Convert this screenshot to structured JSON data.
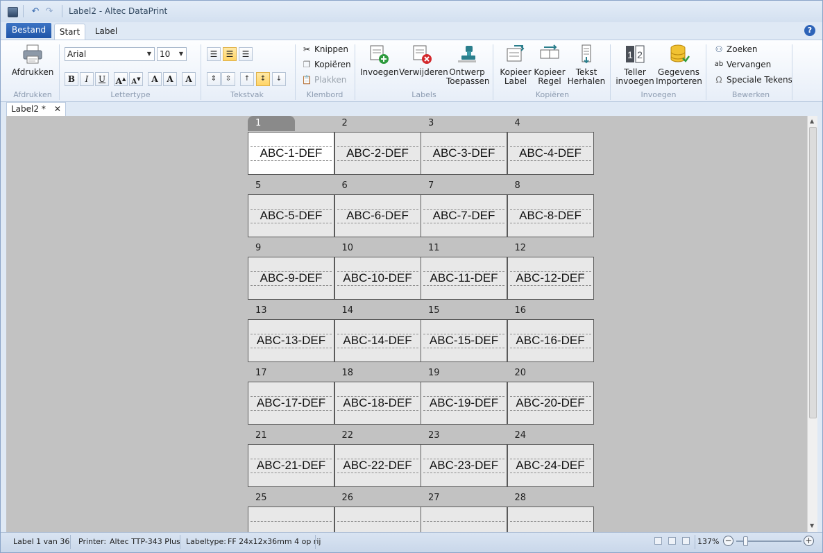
{
  "window": {
    "title": "Label2 - Altec DataPrint"
  },
  "ribbon_tabs": {
    "file": "Bestand",
    "start": "Start",
    "label": "Label"
  },
  "groups": {
    "afdrukken": "Afdrukken",
    "lettertype": "Lettertype",
    "tekstvak": "Tekstvak",
    "klembord": "Klembord",
    "labels": "Labels",
    "kopieren": "Kopiëren",
    "invoegen": "Invoegen",
    "bewerken": "Bewerken"
  },
  "buttons": {
    "print": "Afdrukken",
    "cut": "Knippen",
    "copy": "Kopiëren",
    "paste": "Plakken",
    "insert_l1": "Invoegen",
    "delete_l1": "Verwijderen",
    "design_l1": "Ontwerp",
    "design_l2": "Toepassen",
    "copylabel_l1": "Kopieer",
    "copylabel_l2": "Label",
    "copyrow_l1": "Kopieer",
    "copyrow_l2": "Regel",
    "repeat_l1": "Tekst",
    "repeat_l2": "Herhalen",
    "counter_l1": "Teller",
    "counter_l2": "invoegen",
    "import_l1": "Gegevens",
    "import_l2": "Importeren",
    "find": "Zoeken",
    "replace": "Vervangen",
    "special": "Speciale Tekens"
  },
  "font": {
    "name": "Arial",
    "size": "10"
  },
  "doc_tab": {
    "name": "Label2 *"
  },
  "labels": {
    "rows": [
      {
        "nums": [
          "1",
          "2",
          "3",
          "4"
        ],
        "texts": [
          "ABC-1-DEF",
          "ABC-2-DEF",
          "ABC-3-DEF",
          "ABC-4-DEF"
        ]
      },
      {
        "nums": [
          "5",
          "6",
          "7",
          "8"
        ],
        "texts": [
          "ABC-5-DEF",
          "ABC-6-DEF",
          "ABC-7-DEF",
          "ABC-8-DEF"
        ]
      },
      {
        "nums": [
          "9",
          "10",
          "11",
          "12"
        ],
        "texts": [
          "ABC-9-DEF",
          "ABC-10-DEF",
          "ABC-11-DEF",
          "ABC-12-DEF"
        ]
      },
      {
        "nums": [
          "13",
          "14",
          "15",
          "16"
        ],
        "texts": [
          "ABC-13-DEF",
          "ABC-14-DEF",
          "ABC-15-DEF",
          "ABC-16-DEF"
        ]
      },
      {
        "nums": [
          "17",
          "18",
          "19",
          "20"
        ],
        "texts": [
          "ABC-17-DEF",
          "ABC-18-DEF",
          "ABC-19-DEF",
          "ABC-20-DEF"
        ]
      },
      {
        "nums": [
          "21",
          "22",
          "23",
          "24"
        ],
        "texts": [
          "ABC-21-DEF",
          "ABC-22-DEF",
          "ABC-23-DEF",
          "ABC-24-DEF"
        ]
      },
      {
        "nums": [
          "25",
          "26",
          "27",
          "28"
        ],
        "texts": [
          "",
          "",
          "",
          ""
        ]
      }
    ]
  },
  "status": {
    "label": "Label 1 van 36",
    "printer_label": "Printer:",
    "printer": "Altec TTP-343 Plus",
    "labeltype_label": "Labeltype:",
    "labeltype": "FF 24x12x36mm 4 op rij",
    "zoom": "137%"
  },
  "colors": {
    "accent": "#1f55a8",
    "canvas": "#c2c2c2",
    "active_tab": "#8a8a8a"
  }
}
